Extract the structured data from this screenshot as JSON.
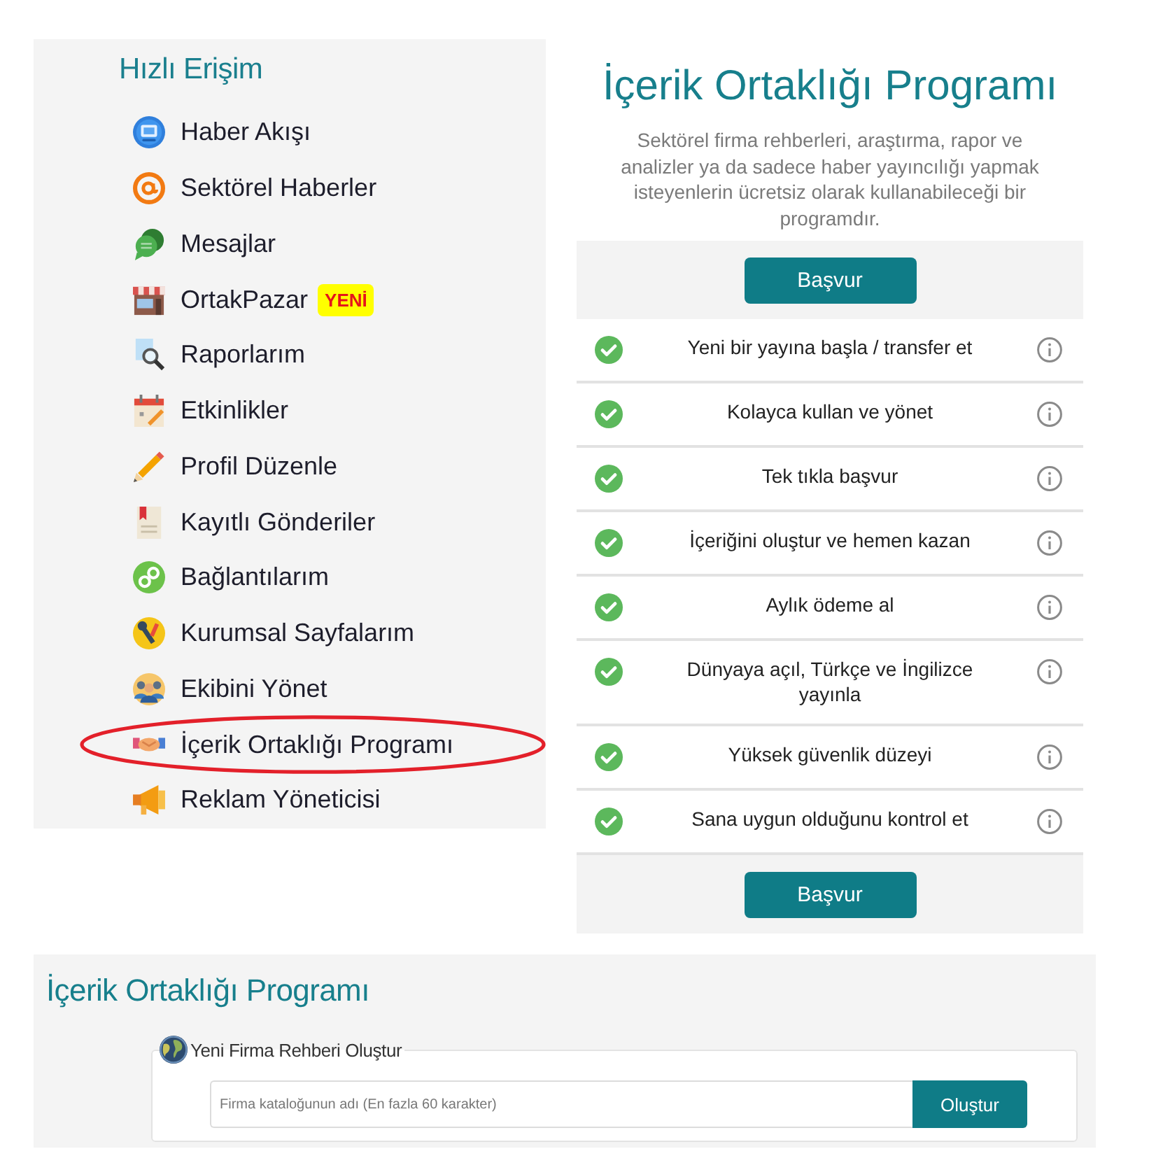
{
  "quick_access": {
    "title": "Hızlı Erişim",
    "items": [
      {
        "label": "Haber Akışı",
        "circled": false
      },
      {
        "label": "Sektörel Haberler",
        "circled": false
      },
      {
        "label": "Mesajlar",
        "circled": false
      },
      {
        "label": "OrtakPazar",
        "badge": "YENİ",
        "circled": false
      },
      {
        "label": "Raporlarım",
        "circled": false
      },
      {
        "label": "Etkinlikler",
        "circled": false
      },
      {
        "label": "Profil Düzenle",
        "circled": false
      },
      {
        "label": "Kayıtlı Gönderiler",
        "circled": false
      },
      {
        "label": "Bağlantılarım",
        "circled": false
      },
      {
        "label": "Kurumsal Sayfalarım",
        "circled": false
      },
      {
        "label": "Ekibini Yönet",
        "circled": false
      },
      {
        "label": "İçerik Ortaklığı Programı",
        "circled": true
      },
      {
        "label": "Reklam Yöneticisi",
        "circled": false
      }
    ]
  },
  "program_panel": {
    "title": "İçerik Ortaklığı Programı",
    "description": "Sektörel firma rehberleri, araştırma, rapor ve analizler ya da sadece haber yayıncılığı yapmak isteyenlerin ücretsiz olarak kullanabileceği bir programdır.",
    "top_button": "Başvur",
    "features": [
      {
        "text": "Yeni bir yayına başla / transfer et",
        "checked": true
      },
      {
        "text": "Kolayca kullan ve yönet",
        "checked": true
      },
      {
        "text": "Tek tıkla başvur",
        "checked": true
      },
      {
        "text": "İçeriğini oluştur ve hemen kazan",
        "checked": true
      },
      {
        "text": "Aylık ödeme al",
        "checked": true
      },
      {
        "text": "Dünyaya açıl, Türkçe ve İngilizce yayınla",
        "checked": true
      },
      {
        "text": "Yüksek güvenlik düzeyi",
        "checked": true
      },
      {
        "text": "Sana uygun olduğunu kontrol et",
        "checked": true
      }
    ],
    "bottom_button": "Başvur"
  },
  "create_section": {
    "title": "İçerik Ortaklığı Programı",
    "legend": "Yeni Firma Rehberi Oluştur",
    "name_field": {
      "placeholder": "Firma kataloğunun adı (En fazla 60 karakter)"
    },
    "submit_button": "Oluştur"
  }
}
